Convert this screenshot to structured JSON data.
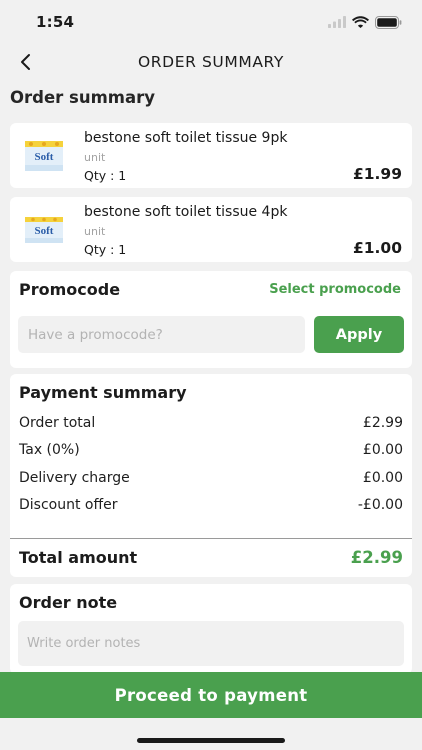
{
  "status_bar": {
    "time": "1:54"
  },
  "header": {
    "title": "ORDER SUMMARY"
  },
  "section_title": "Order summary",
  "items": [
    {
      "name": "bestone soft toilet tissue 9pk",
      "unit": "unit",
      "qty": "Qty : 1",
      "price": "£1.99",
      "thumb_text": "Soft"
    },
    {
      "name": "bestone soft toilet tissue 4pk",
      "unit": "unit",
      "qty": "Qty : 1",
      "price": "£1.00",
      "thumb_text": "Soft"
    }
  ],
  "promo": {
    "title": "Promocode",
    "select_link": "Select promocode",
    "placeholder": "Have a promocode?",
    "apply_label": "Apply"
  },
  "payment": {
    "title": "Payment summary",
    "rows": [
      {
        "label": "Order total",
        "value": "£2.99"
      },
      {
        "label": "Tax (0%)",
        "value": "£0.00"
      },
      {
        "label": "Delivery charge",
        "value": "£0.00"
      },
      {
        "label": "Discount offer",
        "value": "-£0.00"
      }
    ],
    "total_label": "Total amount",
    "total_value": "£2.99"
  },
  "note": {
    "title": "Order note",
    "placeholder": "Write order notes"
  },
  "proceed_label": "Proceed to payment",
  "colors": {
    "accent": "#4aa04e",
    "background": "#f1f1f1",
    "card": "#ffffff"
  }
}
